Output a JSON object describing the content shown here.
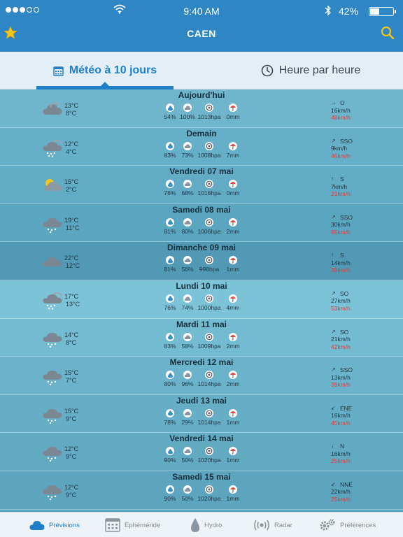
{
  "status": {
    "time": "9:40 AM",
    "battery": "42%",
    "battery_level": 0.42,
    "signal_dots": 3
  },
  "header": {
    "title": "CAEN"
  },
  "tabs": [
    {
      "label": "Météo à 10 jours",
      "active": true,
      "icon": "calendar-icon"
    },
    {
      "label": "Heure par heure",
      "active": false,
      "icon": "clock-icon"
    }
  ],
  "days": [
    {
      "name": "Aujourd'hui",
      "icon": "cloudy",
      "tmax": "13°C",
      "tmin": "8°C",
      "humidity": "54%",
      "cloud": "100%",
      "pressure": "1013hpa",
      "rain": "0mm",
      "dir_arrow": "→",
      "dir": "O",
      "wind": "16km/h",
      "gust": "48km/h",
      "bg": "#6fb5cc"
    },
    {
      "name": "Demain",
      "icon": "rain",
      "tmax": "12°C",
      "tmin": "4°C",
      "humidity": "83%",
      "cloud": "73%",
      "pressure": "1008hpa",
      "rain": "7mm",
      "dir_arrow": "↗",
      "dir": "SSO",
      "wind": "9km/h",
      "gust": "46km/h",
      "bg": "#66afc8"
    },
    {
      "name": "Vendredi 07 mai",
      "icon": "partly",
      "tmax": "15°C",
      "tmin": "2°C",
      "humidity": "76%",
      "cloud": "68%",
      "pressure": "1016hpa",
      "rain": "0mm",
      "dir_arrow": "↑",
      "dir": "S",
      "wind": "7km/h",
      "gust": "21km/h",
      "bg": "#62abc5"
    },
    {
      "name": "Samedi 08 mai",
      "icon": "showers",
      "tmax": "19°C",
      "tmin": "11°C",
      "humidity": "81%",
      "cloud": "80%",
      "pressure": "1006hpa",
      "rain": "2mm",
      "dir_arrow": "↗",
      "dir": "SSO",
      "wind": "30km/h",
      "gust": "65km/h",
      "bg": "#5aa5c0"
    },
    {
      "name": "Dimanche 09 mai",
      "icon": "cloud-only",
      "tmax": "22°C",
      "tmin": "12°C",
      "humidity": "81%",
      "cloud": "56%",
      "pressure": "998hpa",
      "rain": "1mm",
      "dir_arrow": "↑",
      "dir": "S",
      "wind": "14km/h",
      "gust": "39km/h",
      "bg": "#5199b5"
    },
    {
      "name": "Lundi 10 mai",
      "icon": "rain",
      "tmax": "17°C",
      "tmin": "13°C",
      "humidity": "76%",
      "cloud": "74%",
      "pressure": "1000hpa",
      "rain": "4mm",
      "dir_arrow": "↗",
      "dir": "SO",
      "wind": "27km/h",
      "gust": "53km/h",
      "bg": "#7dc3d8"
    },
    {
      "name": "Mardi 11 mai",
      "icon": "showers",
      "tmax": "14°C",
      "tmin": "8°C",
      "humidity": "83%",
      "cloud": "58%",
      "pressure": "1009hpa",
      "rain": "2mm",
      "dir_arrow": "↗",
      "dir": "SO",
      "wind": "21km/h",
      "gust": "42km/h",
      "bg": "#72bbd1"
    },
    {
      "name": "Mercredi 12 mai",
      "icon": "showers",
      "tmax": "15°C",
      "tmin": "7°C",
      "humidity": "80%",
      "cloud": "96%",
      "pressure": "1014hpa",
      "rain": "2mm",
      "dir_arrow": "↗",
      "dir": "SSO",
      "wind": "13km/h",
      "gust": "39km/h",
      "bg": "#6ab3ca"
    },
    {
      "name": "Jeudi 13 mai",
      "icon": "showers",
      "tmax": "15°C",
      "tmin": "9°C",
      "humidity": "78%",
      "cloud": "29%",
      "pressure": "1014hpa",
      "rain": "1mm",
      "dir_arrow": "↙",
      "dir": "ENE",
      "wind": "16km/h",
      "gust": "45km/h",
      "bg": "#66aec6"
    },
    {
      "name": "Vendredi 14 mai",
      "icon": "showers",
      "tmax": "12°C",
      "tmin": "9°C",
      "humidity": "90%",
      "cloud": "50%",
      "pressure": "1020hpa",
      "rain": "1mm",
      "dir_arrow": "↓",
      "dir": "N",
      "wind": "16km/h",
      "gust": "25km/h",
      "bg": "#62a9c2"
    },
    {
      "name": "Samedi 15 mai",
      "icon": "showers",
      "tmax": "12°C",
      "tmin": "9°C",
      "humidity": "90%",
      "cloud": "50%",
      "pressure": "1020hpa",
      "rain": "1mm",
      "dir_arrow": "↙",
      "dir": "NNE",
      "wind": "22km/h",
      "gust": "25km/h",
      "bg": "#5da4be"
    }
  ],
  "bottom_tabs": [
    {
      "label": "Prévisions",
      "icon": "cloud-icon",
      "active": true
    },
    {
      "label": "Éphéméride",
      "icon": "calendar-grid-icon",
      "active": false
    },
    {
      "label": "Hydro",
      "icon": "drop-icon",
      "active": false
    },
    {
      "label": "Radar",
      "icon": "radar-icon",
      "active": false
    },
    {
      "label": "Préférences",
      "icon": "gears-icon",
      "active": false
    }
  ],
  "colors": {
    "header_bg": "#2f86c4",
    "accent": "#1f7fc7",
    "gust": "#e23a3a",
    "star": "#f5c518"
  }
}
